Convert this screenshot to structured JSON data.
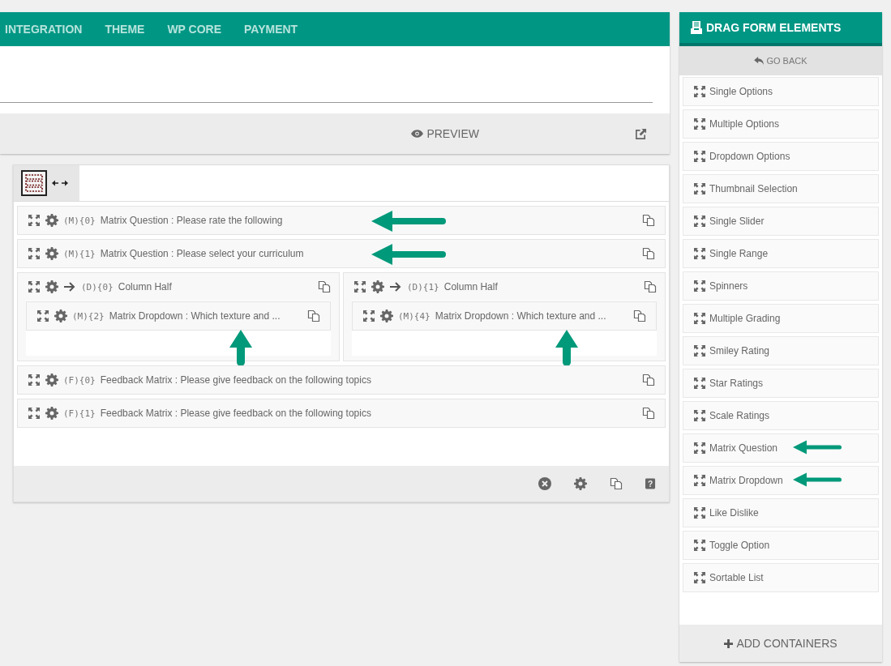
{
  "nav_tabs": [
    "INTEGRATION",
    "THEME",
    "WP CORE",
    "PAYMENT"
  ],
  "toolbar": {
    "preview": "PREVIEW"
  },
  "builder": {
    "rows": [
      {
        "kind": "element",
        "code": "(M){0}",
        "label": "Matrix Question : Please rate the following",
        "annotated": true
      },
      {
        "kind": "element",
        "code": "(M){1}",
        "label": "Matrix Question : Please select your curriculum",
        "annotated": true
      },
      {
        "kind": "columns",
        "columns": [
          {
            "code": "(D){0}",
            "label": "Column Half",
            "children": [
              {
                "code": "(M){2}",
                "label": "Matrix Dropdown : Which texture and ...",
                "annotated": true
              }
            ]
          },
          {
            "code": "(D){1}",
            "label": "Column Half",
            "children": [
              {
                "code": "(M){4}",
                "label": "Matrix Dropdown : Which texture and ...",
                "annotated": true
              }
            ]
          }
        ]
      },
      {
        "kind": "element",
        "code": "(F){0}",
        "label": "Feedback Matrix : Please give feedback on the following topics",
        "annotated": false
      },
      {
        "kind": "element",
        "code": "(F){1}",
        "label": "Feedback Matrix : Please give feedback on the following topics",
        "annotated": false
      }
    ],
    "footer": {
      "help": "?"
    }
  },
  "sidebar": {
    "title": "DRAG FORM ELEMENTS",
    "back": "GO BACK",
    "items": [
      {
        "label": "Single Options",
        "annotated": false
      },
      {
        "label": "Multiple Options",
        "annotated": false
      },
      {
        "label": "Dropdown Options",
        "annotated": false
      },
      {
        "label": "Thumbnail Selection",
        "annotated": false
      },
      {
        "label": "Single Slider",
        "annotated": false
      },
      {
        "label": "Single Range",
        "annotated": false
      },
      {
        "label": "Spinners",
        "annotated": false
      },
      {
        "label": "Multiple Grading",
        "annotated": false
      },
      {
        "label": "Smiley Rating",
        "annotated": false
      },
      {
        "label": "Star Ratings",
        "annotated": false
      },
      {
        "label": "Scale Ratings",
        "annotated": false
      },
      {
        "label": "Matrix Question",
        "annotated": true
      },
      {
        "label": "Matrix Dropdown",
        "annotated": true
      },
      {
        "label": "Like Dislike",
        "annotated": false
      },
      {
        "label": "Toggle Option",
        "annotated": false
      },
      {
        "label": "Sortable List",
        "annotated": false
      }
    ],
    "add": "ADD CONTAINERS"
  }
}
